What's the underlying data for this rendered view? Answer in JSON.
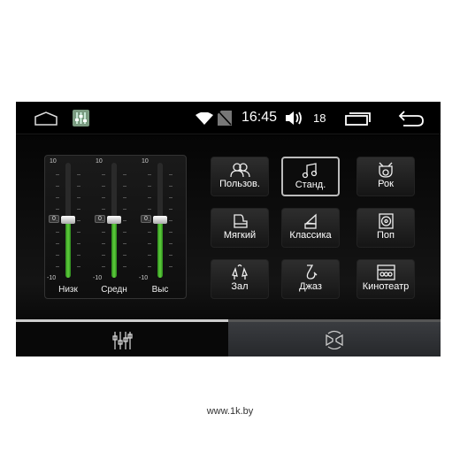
{
  "status_bar": {
    "time": "16:45",
    "volume": "18",
    "icons": [
      "home-icon",
      "equalizer-app-icon",
      "wifi-icon",
      "no-sim-icon",
      "volume-icon",
      "recent-apps-icon",
      "back-icon"
    ]
  },
  "equalizer": {
    "max_label": "10",
    "min_label": "-10",
    "sliders": [
      {
        "label": "Низк",
        "value": 0
      },
      {
        "label": "Средн",
        "value": 0
      },
      {
        "label": "Выс",
        "value": 0
      }
    ]
  },
  "presets": [
    {
      "label": "Пользов.",
      "icon": "users-icon",
      "selected": false
    },
    {
      "label": "Станд.",
      "icon": "music-note-icon",
      "selected": true
    },
    {
      "label": "Рок",
      "icon": "drum-icon",
      "selected": false
    },
    {
      "label": "Мягкий",
      "icon": "piano-icon",
      "selected": false
    },
    {
      "label": "Классика",
      "icon": "gramophone-icon",
      "selected": false
    },
    {
      "label": "Поп",
      "icon": "speaker-icon",
      "selected": false
    },
    {
      "label": "Зал",
      "icon": "champagne-icon",
      "selected": false
    },
    {
      "label": "Джаз",
      "icon": "saxophone-icon",
      "selected": false
    },
    {
      "label": "Кинотеатр",
      "icon": "theater-icon",
      "selected": false
    }
  ],
  "tabs": [
    {
      "icon": "equalizer-sliders-icon",
      "active": true
    },
    {
      "icon": "speaker-balance-icon",
      "active": false
    }
  ],
  "colors": {
    "accent_green": "#5fd03c"
  },
  "footer": "www.1k.by"
}
